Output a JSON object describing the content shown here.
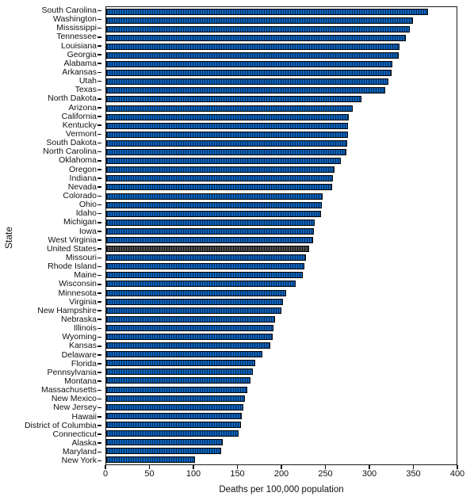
{
  "chart_data": {
    "type": "bar",
    "orientation": "horizontal",
    "title": "",
    "xlabel": "Deaths per 100,000 population",
    "ylabel": "State",
    "xlim": [
      0,
      400
    ],
    "xticks": [
      0,
      50,
      100,
      150,
      200,
      250,
      300,
      350,
      400
    ],
    "grid": false,
    "legend": null,
    "highlight_category": "United States",
    "colors": {
      "bar": "#0b63be",
      "bar_edge": "#000000",
      "highlight_bar": "#3a3a3a",
      "axis": "#1a1a1a",
      "text": "#111111",
      "background": "#ffffff"
    },
    "categories": [
      "South Carolina",
      "Washington",
      "Mississippi",
      "Tennessee",
      "Louisiana",
      "Georgia",
      "Alabama",
      "Arkansas",
      "Utah",
      "Texas",
      "North Dakota",
      "Arizona",
      "California",
      "Kentucky",
      "Vermont",
      "South Dakota",
      "North Carolina",
      "Oklahoma",
      "Oregon",
      "Indiana",
      "Nevada",
      "Colorado",
      "Ohio",
      "Idaho",
      "Michigan",
      "Iowa",
      "West Virginia",
      "United States",
      "Missouri",
      "Rhode Island",
      "Maine",
      "Wisconsin",
      "Minnesota",
      "Virginia",
      "New Hampshire",
      "Nebraska",
      "Illinois",
      "Wyoming",
      "Kansas",
      "Delaware",
      "Florida",
      "Pennsylvania",
      "Montana",
      "Massachusetts",
      "New Mexico",
      "New Jersey",
      "Hawaii",
      "District of Columbia",
      "Connecticut",
      "Alaska",
      "Maryland",
      "New York"
    ],
    "values": [
      367,
      350,
      347,
      342,
      335,
      334,
      327,
      326,
      322,
      319,
      291,
      281,
      277,
      276,
      276,
      275,
      274,
      268,
      261,
      259,
      258,
      247,
      246,
      245,
      238,
      237,
      236,
      232,
      228,
      226,
      224,
      216,
      205,
      202,
      200,
      193,
      191,
      190,
      187,
      178,
      170,
      167,
      165,
      161,
      158,
      157,
      155,
      154,
      151,
      133,
      131,
      101
    ]
  }
}
